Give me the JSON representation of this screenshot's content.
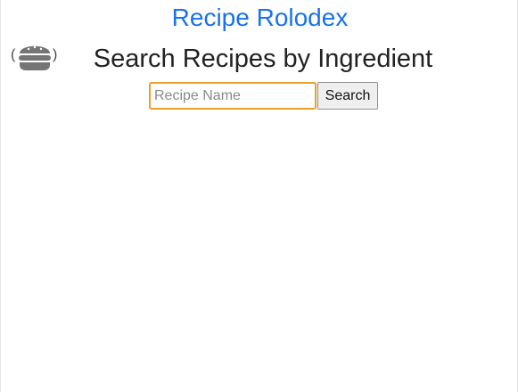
{
  "header": {
    "app_title": "Recipe Rolodex",
    "heading": "Search Recipes by Ingredient"
  },
  "logo": {
    "icon": "burger-icon",
    "paren_left": "(",
    "paren_right": ")",
    "color": "#757575"
  },
  "search": {
    "value": "",
    "placeholder": "Recipe Name",
    "button_label": "Search"
  },
  "colors": {
    "link": "#1a73e8",
    "focus_border": "#e6a12c"
  }
}
